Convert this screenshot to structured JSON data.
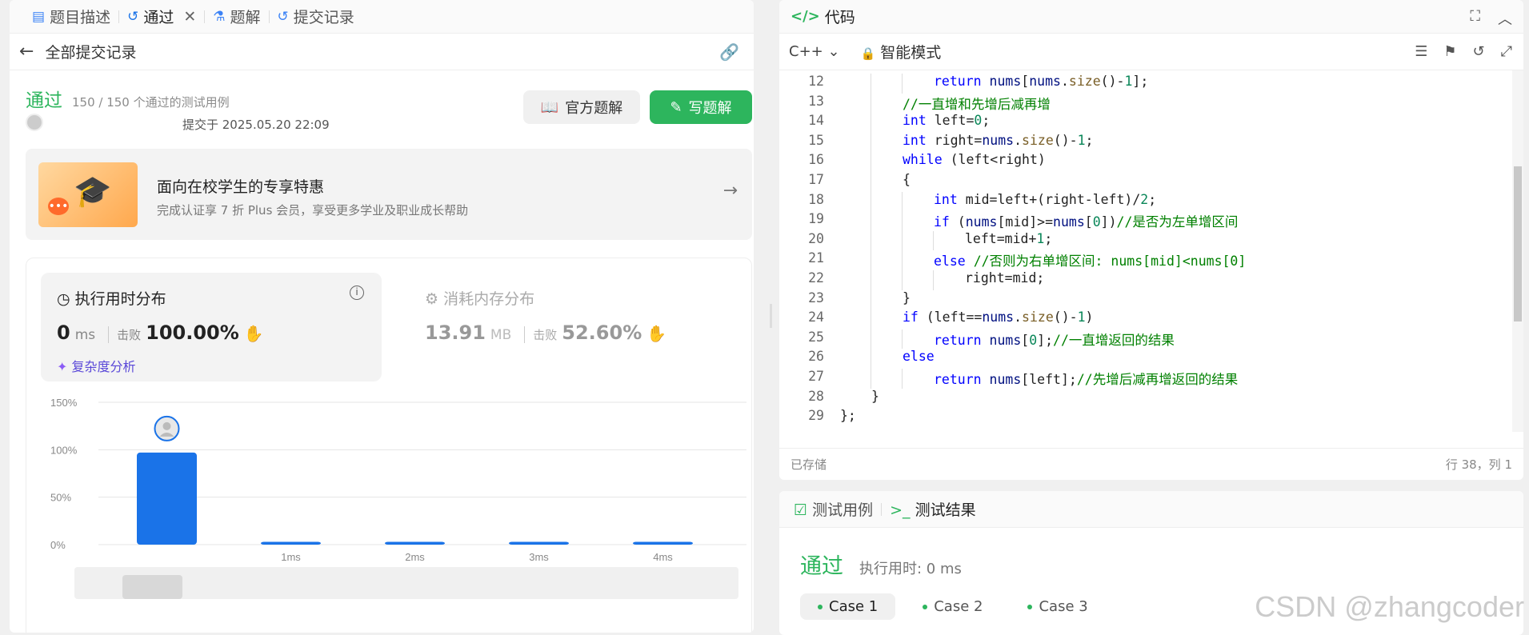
{
  "left_tabs": [
    {
      "label": "题目描述",
      "icon": "doc-icon"
    },
    {
      "label": "通过",
      "icon": "history-icon",
      "active": true
    },
    {
      "label": "题解",
      "icon": "flask-icon"
    },
    {
      "label": "提交记录",
      "icon": "history-icon"
    }
  ],
  "subheader": {
    "back_label": "全部提交记录"
  },
  "submission": {
    "status": "通过",
    "cases_text": "150 / 150 个通过的测试用例",
    "submit_time": "提交于 2025.05.20 22:09",
    "official_solution_label": "官方题解",
    "write_solution_label": "写题解"
  },
  "promo": {
    "title": "面向在校学生的专享特惠",
    "subtitle": "完成认证享 7 折 Plus 会员，享受更多学业及职业成长帮助"
  },
  "runtime": {
    "title": "执行用时分布",
    "value": "0",
    "unit": "ms",
    "beats_label": "击败",
    "beats_pct": "100.00%",
    "complexity_label": "复杂度分析"
  },
  "memory": {
    "title": "消耗内存分布",
    "value": "13.91",
    "unit": "MB",
    "beats_label": "击败",
    "beats_pct": "52.60%"
  },
  "chart_data": {
    "type": "bar",
    "categories": [
      "",
      "1ms",
      "2ms",
      "3ms",
      "4ms"
    ],
    "values": [
      97,
      3,
      3,
      3,
      3
    ],
    "yticks": [
      "0%",
      "50%",
      "100%",
      "150%"
    ],
    "ylim": [
      0,
      150
    ],
    "color": "#1a73e8",
    "grid": true
  },
  "editor": {
    "title": "代码",
    "language": "C++",
    "mode": "智能模式",
    "saved": "已存储",
    "cursor": "行 38，列 1"
  },
  "code_lines": [
    {
      "n": "12",
      "indent": 3,
      "html": "<span class='kw'>return</span> <span class='vr'>nums</span>[<span class='vr'>nums</span>.<span class='fn'>size</span>()-<span class='num'>1</span>];"
    },
    {
      "n": "13",
      "indent": 2,
      "html": "<span class='cm'>//一直增和先增后减再增</span>"
    },
    {
      "n": "14",
      "indent": 2,
      "html": "<span class='ty'>int</span> left=<span class='num'>0</span>;"
    },
    {
      "n": "15",
      "indent": 2,
      "html": "<span class='ty'>int</span> right=<span class='vr'>nums</span>.<span class='fn'>size</span>()-<span class='num'>1</span>;"
    },
    {
      "n": "16",
      "indent": 2,
      "html": "<span class='kw'>while</span> (left&lt;right)"
    },
    {
      "n": "17",
      "indent": 2,
      "html": "{"
    },
    {
      "n": "18",
      "indent": 3,
      "html": "<span class='ty'>int</span> mid=left+(right-left)/<span class='num'>2</span>;"
    },
    {
      "n": "19",
      "indent": 3,
      "html": "<span class='kw'>if</span> (<span class='vr'>nums</span>[mid]&gt;=<span class='vr'>nums</span>[<span class='num'>0</span>])<span class='cm'>//是否为左单增区间</span>"
    },
    {
      "n": "20",
      "indent": 4,
      "html": "left=mid+<span class='num'>1</span>;"
    },
    {
      "n": "21",
      "indent": 3,
      "html": "<span class='kw'>else</span> <span class='cm'>//否则为右单增区间: nums[mid]&lt;nums[0]</span>"
    },
    {
      "n": "22",
      "indent": 4,
      "html": "right=mid;"
    },
    {
      "n": "23",
      "indent": 2,
      "html": "}"
    },
    {
      "n": "24",
      "indent": 2,
      "html": "<span class='kw'>if</span> (left==<span class='vr'>nums</span>.<span class='fn'>size</span>()-<span class='num'>1</span>)"
    },
    {
      "n": "25",
      "indent": 3,
      "html": "<span class='kw'>return</span> <span class='vr'>nums</span>[<span class='num'>0</span>];<span class='cm'>//一直增返回的结果</span>"
    },
    {
      "n": "26",
      "indent": 2,
      "html": "<span class='kw'>else</span>"
    },
    {
      "n": "27",
      "indent": 3,
      "html": "<span class='kw'>return</span> <span class='vr'>nums</span>[left];<span class='cm'>//先增后减再增返回的结果</span>"
    },
    {
      "n": "28",
      "indent": 1,
      "html": "}"
    },
    {
      "n": "29",
      "indent": 0,
      "html": "};"
    }
  ],
  "bottom_tabs": [
    {
      "label": "测试用例",
      "icon": "checkbox-icon"
    },
    {
      "label": "测试结果",
      "icon": "terminal-icon",
      "active": true
    }
  ],
  "test_result": {
    "status": "通过",
    "runtime": "执行用时: 0 ms",
    "cases": [
      "Case 1",
      "Case 2",
      "Case 3"
    ]
  },
  "watermark": "CSDN @zhangcoder"
}
